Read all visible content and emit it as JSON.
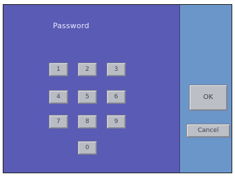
{
  "dialog": {
    "title": "Password"
  },
  "keypad": {
    "keys": [
      "1",
      "2",
      "3",
      "4",
      "5",
      "6",
      "7",
      "8",
      "9",
      "0"
    ]
  },
  "actions": {
    "ok_label": "OK",
    "cancel_label": "Cancel"
  },
  "colors": {
    "panel": "#5a5bb4",
    "side": "#6b96c9",
    "button": "#bcbfc6"
  }
}
